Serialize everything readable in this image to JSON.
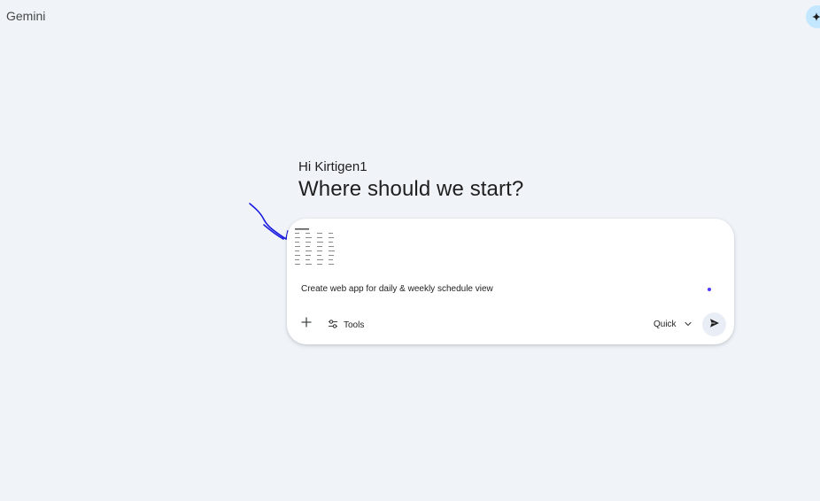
{
  "header": {
    "app_title": "Gemini"
  },
  "main": {
    "greeting": "Hi Kirtigen1",
    "headline": "Where should we start?"
  },
  "composer": {
    "prompt_text": "Create web app for daily & weekly schedule view",
    "tools_label": "Tools",
    "mode_label": "Quick"
  },
  "icons": {
    "top_right": "sparkle-icon",
    "add": "plus-icon",
    "tools": "tune-icon",
    "mode": "chevron-down-icon",
    "send": "send-icon"
  },
  "colors": {
    "background": "#f0f4f9",
    "composer_bg": "#ffffff",
    "accent_button": "#c2e7ff",
    "send_button_bg": "#e9eef6",
    "annotation_ink": "#1a1adf",
    "mic_dot": "#4b3cff"
  }
}
